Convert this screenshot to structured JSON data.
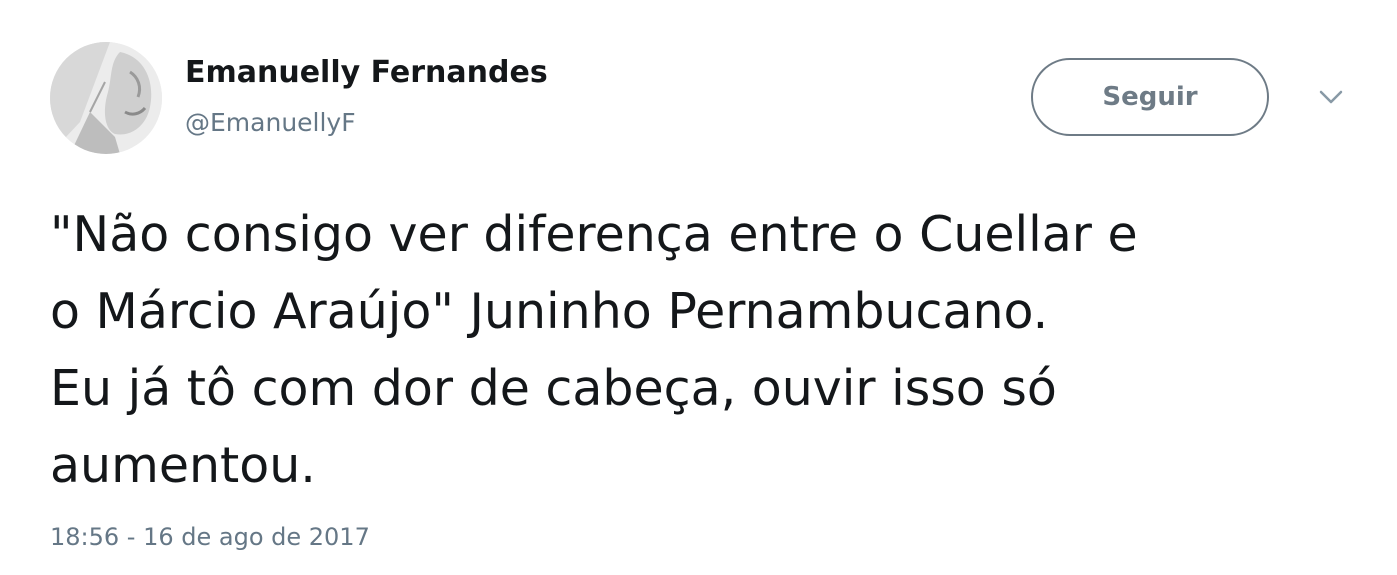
{
  "user": {
    "display_name": "Emanuelly Fernandes",
    "handle": "@EmanuellyF"
  },
  "actions": {
    "follow_label": "Seguir",
    "menu_icon": "chevron-down-icon",
    "follow_border_color": "#6e7b86"
  },
  "tweet": {
    "text": "\"Não consigo ver diferença entre o Cuellar e\no Márcio Araújo\" Juninho Pernambucano.\nEu já tô com dor de cabeça, ouvir isso só\naumentou.",
    "timestamp": "18:56 - 16 de ago de 2017"
  }
}
